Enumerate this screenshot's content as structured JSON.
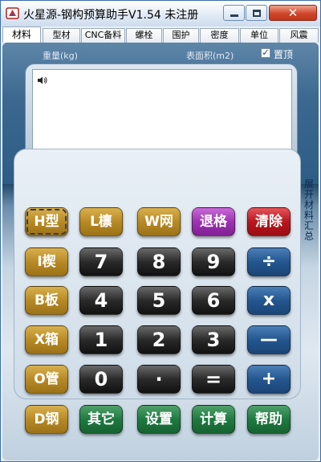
{
  "window": {
    "title": "火星源-钢构预算助手V1.54 未注册",
    "close_symbol": "✕"
  },
  "tabs": [
    {
      "label": "材料",
      "active": true
    },
    {
      "label": "型材"
    },
    {
      "label": "CNC备料"
    },
    {
      "label": "螺栓"
    },
    {
      "label": "围护"
    },
    {
      "label": "密度"
    },
    {
      "label": "单位"
    },
    {
      "label": "风震"
    }
  ],
  "header": {
    "weight_label": "重量(kg)",
    "area_label": "表面积(m2)",
    "pin_checkbox_mark": "✓",
    "pin_label": "置顶"
  },
  "display": {
    "speaker_icon": "speaker-icon",
    "value": ""
  },
  "side_link": "展开材料汇总",
  "keys": {
    "row1": [
      "H型",
      "L檩",
      "W网",
      "退格",
      "清除"
    ],
    "row2": [
      "I楔",
      "7",
      "8",
      "9",
      "÷"
    ],
    "row3": [
      "B板",
      "4",
      "5",
      "6",
      "x"
    ],
    "row4": [
      "X箱",
      "1",
      "2",
      "3",
      "—"
    ],
    "row5": [
      "O管",
      "0",
      "·",
      "=",
      "+"
    ],
    "row6": [
      "D钢",
      "其它",
      "设置",
      "计算",
      "帮助"
    ]
  },
  "colors": {
    "gold_key": "#b88a25",
    "black_key": "#2a2a2a",
    "blue_key": "#24568f",
    "purple_key": "#9c32b2",
    "red_key": "#b8171f",
    "green_key": "#1f7a41",
    "panel_blue": "#2e5f86"
  }
}
